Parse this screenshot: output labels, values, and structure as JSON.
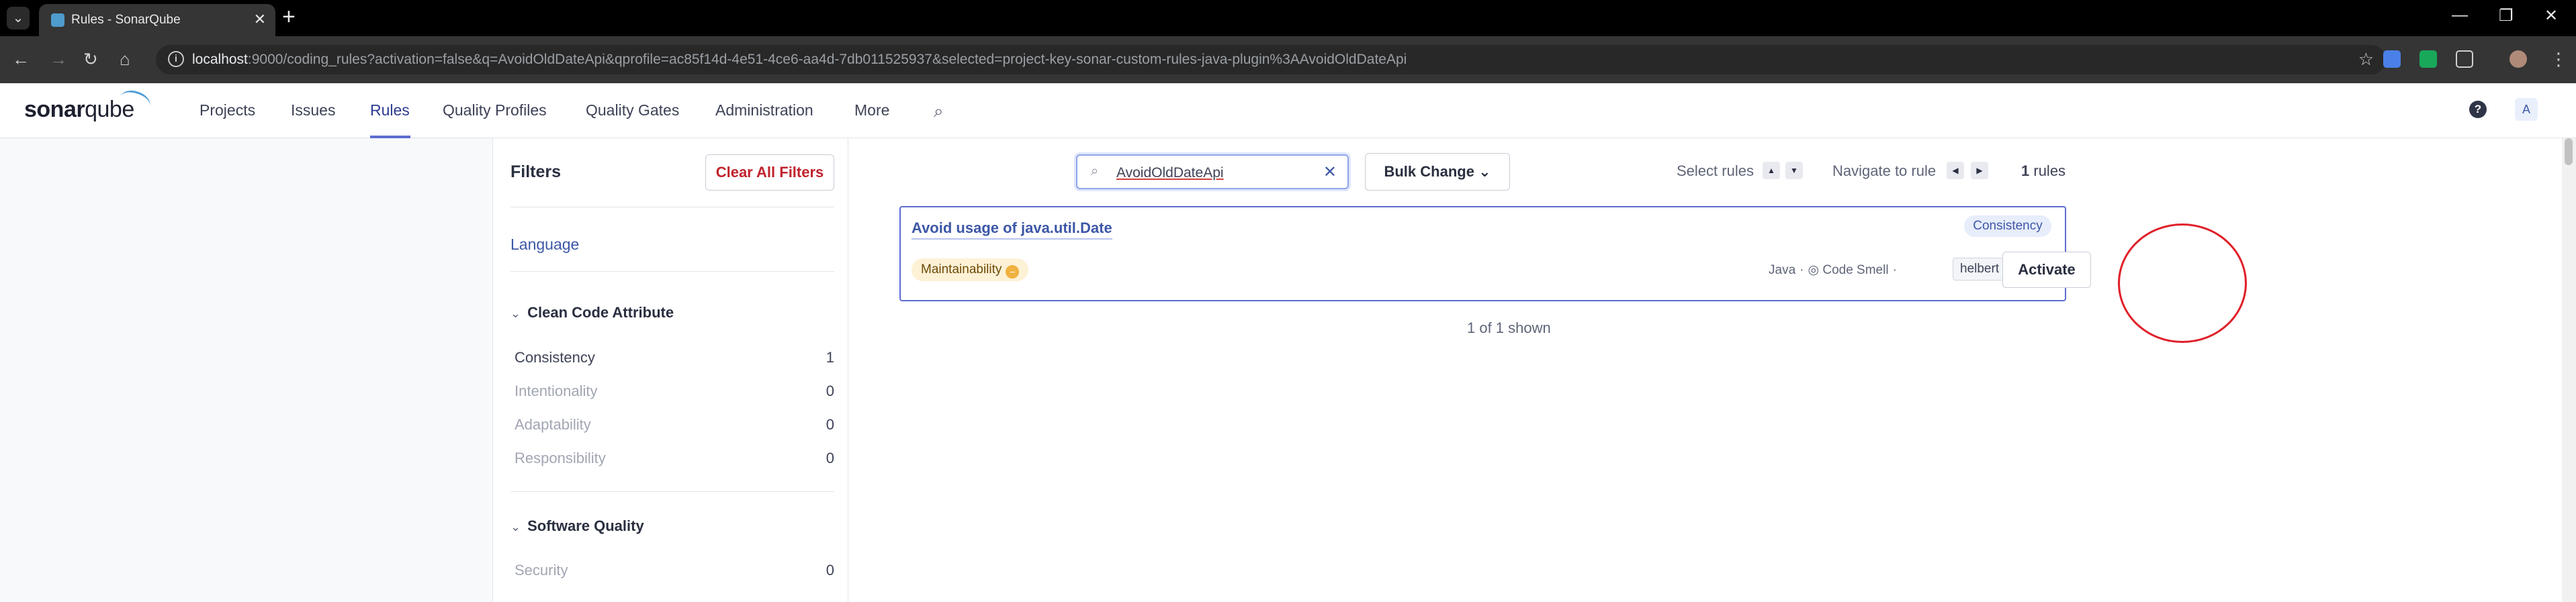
{
  "browser": {
    "tab_title": "Rules - SonarQube",
    "url_host": "localhost",
    "url_rest": ":9000/coding_rules?activation=false&q=AvoidOldDateApi&qprofile=ac85f14d-4e51-4ce6-aa4d-7db011525937&selected=project-key-sonar-custom-rules-java-plugin%3AAvoidOldDateApi"
  },
  "header": {
    "logo_sonar": "sonar",
    "logo_qube": "qube",
    "nav": [
      "Projects",
      "Issues",
      "Rules",
      "Quality Profiles",
      "Quality Gates",
      "Administration",
      "More"
    ],
    "avatar_initial": "A",
    "help": "?"
  },
  "filters": {
    "title": "Filters",
    "clear_label": "Clear All Filters",
    "language_label": "Language",
    "clean_code": {
      "title": "Clean Code Attribute",
      "items": [
        {
          "name": "Consistency",
          "count": "1"
        },
        {
          "name": "Intentionality",
          "count": "0"
        },
        {
          "name": "Adaptability",
          "count": "0"
        },
        {
          "name": "Responsibility",
          "count": "0"
        }
      ]
    },
    "software_quality": {
      "title": "Software Quality",
      "items": [
        {
          "name": "Security",
          "count": "0"
        }
      ]
    }
  },
  "main": {
    "search_value": "AvoidOldDateApi",
    "bulk_change": "Bulk Change",
    "select_rules": "Select rules",
    "navigate_to_rule": "Navigate to rule",
    "count_number": "1",
    "count_label": "rules",
    "rule": {
      "title": "Avoid usage of java.util.Date",
      "attribute": "Consistency",
      "quality_badge": "Maintainability",
      "language": "Java",
      "type": "Code Smell",
      "tag": "helbert",
      "activate": "Activate"
    },
    "shown": "1 of 1 shown"
  },
  "colors": {
    "accent": "#5d6cd0",
    "link": "#3d57a7",
    "danger": "#c0232c",
    "highlight_circle": "#e0202a"
  }
}
